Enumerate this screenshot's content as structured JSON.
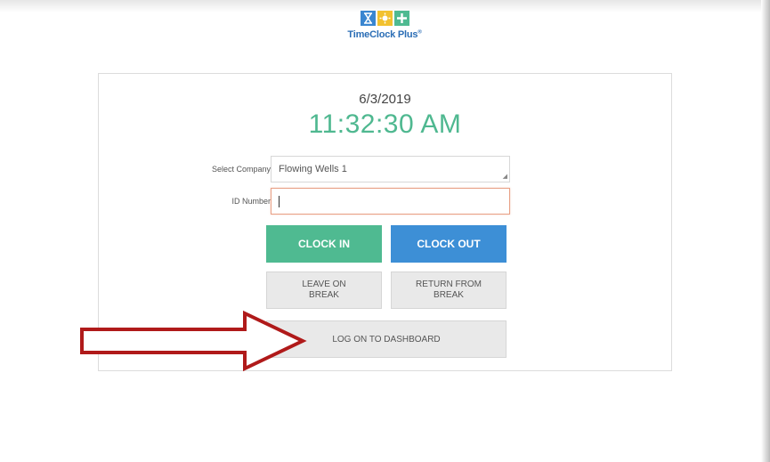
{
  "logo": {
    "title": "TimeClock Plus",
    "mark": "®",
    "icons": [
      "hourglass-icon",
      "sun-icon",
      "plus-icon"
    ],
    "colors": [
      "#3a86d0",
      "#f2c12e",
      "#4fba91"
    ]
  },
  "clock": {
    "date": "6/3/2019",
    "time": "11:32:30 AM"
  },
  "form": {
    "company_label": "Select Company",
    "company_value": "Flowing Wells  1",
    "id_label": "ID Number",
    "id_value": ""
  },
  "buttons": {
    "clock_in": "CLOCK IN",
    "clock_out": "CLOCK OUT",
    "leave_break_line1": "LEAVE ON",
    "leave_break_line2": "BREAK",
    "return_break_line1": "RETURN FROM",
    "return_break_line2": "BREAK",
    "dashboard": "LOG ON TO DASHBOARD"
  },
  "colors": {
    "accent_green": "#4fba91",
    "accent_blue": "#3d8fd6",
    "arrow_red": "#b01a1a"
  }
}
